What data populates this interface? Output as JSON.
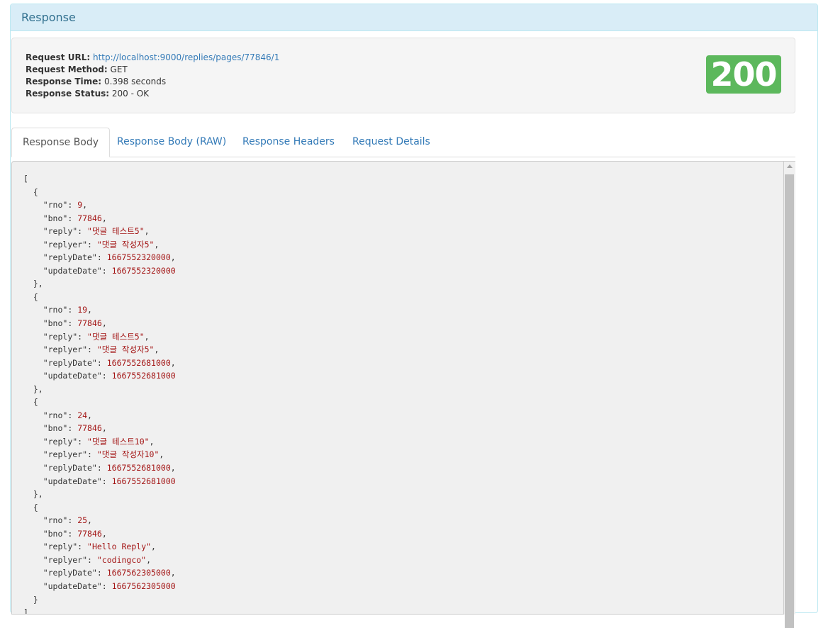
{
  "panel": {
    "title": "Response"
  },
  "summary": {
    "url_label": "Request URL:",
    "url": "http://localhost:9000/replies/pages/77846/1",
    "method_label": "Request Method:",
    "method": "GET",
    "time_label": "Response Time:",
    "time": "0.398 seconds",
    "status_label": "Response Status:",
    "status": "200 - OK",
    "status_code": "200",
    "status_color": "#5cb85c"
  },
  "tabs": [
    {
      "label": "Response Body",
      "active": true
    },
    {
      "label": "Response Body (RAW)",
      "active": false
    },
    {
      "label": "Response Headers",
      "active": false
    },
    {
      "label": "Request Details",
      "active": false
    }
  ],
  "body": {
    "replies": [
      {
        "rno": 9,
        "bno": 77846,
        "reply": "댓글 테스트5",
        "replyer": "댓글 작성자5",
        "replyDate": 1667552320000,
        "updateDate": 1667552320000
      },
      {
        "rno": 19,
        "bno": 77846,
        "reply": "댓글 테스트5",
        "replyer": "댓글 작성자5",
        "replyDate": 1667552681000,
        "updateDate": 1667552681000
      },
      {
        "rno": 24,
        "bno": 77846,
        "reply": "댓글 테스트10",
        "replyer": "댓글 작성자10",
        "replyDate": 1667552681000,
        "updateDate": 1667552681000
      },
      {
        "rno": 25,
        "bno": 77846,
        "reply": "Hello Reply",
        "replyer": "codingco",
        "replyDate": 1667562305000,
        "updateDate": 1667562305000
      }
    ]
  }
}
